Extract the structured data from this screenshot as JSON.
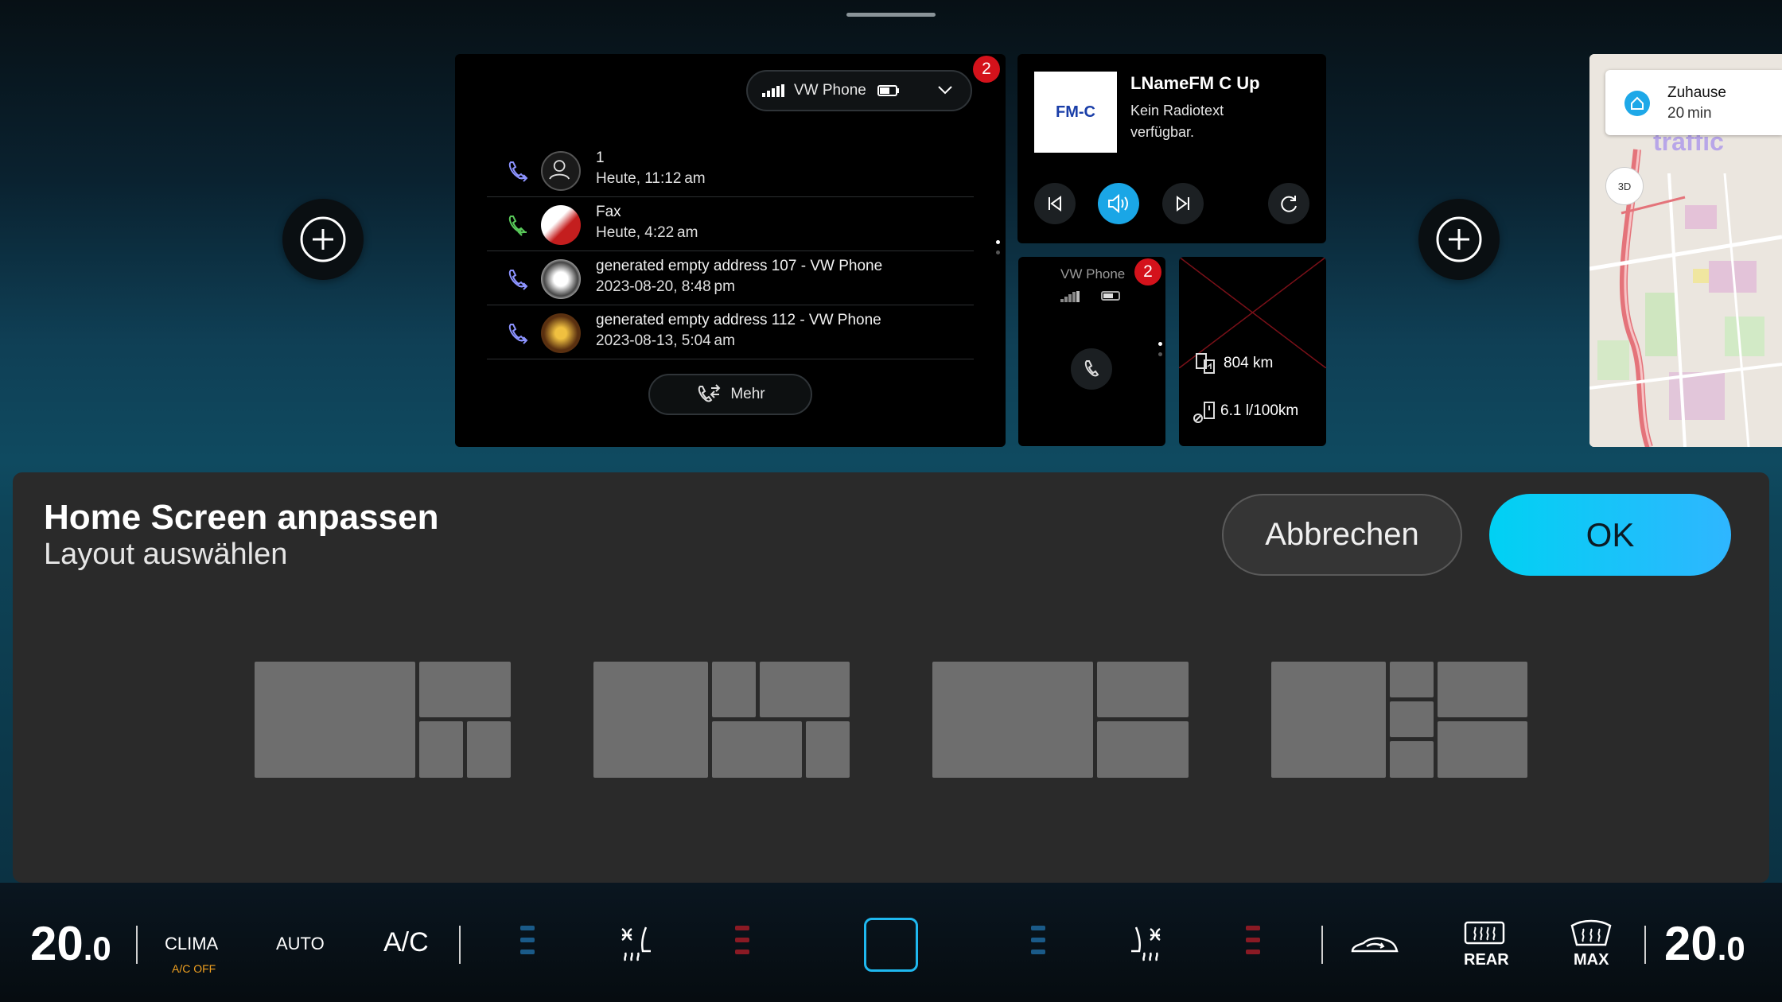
{
  "phone_tile": {
    "badge": "2",
    "device": "VW Phone",
    "calls": [
      {
        "name": "1",
        "time": "Heute, 11:12 am"
      },
      {
        "name": "Fax",
        "time": "Heute, 4:22 am"
      },
      {
        "name": "generated empty address 107 - VW Phone",
        "time": "2023-08-20, 8:48 pm"
      },
      {
        "name": "generated empty address 112 - VW Phone",
        "time": "2023-08-13, 5:04 am"
      }
    ],
    "more_label": "Mehr"
  },
  "radio_tile": {
    "logo": "FM-C",
    "station": "LNameFM C Up",
    "info": "Kein Radiotext verfügbar."
  },
  "phone_small_tile": {
    "device": "VW Phone",
    "badge": "2"
  },
  "trip_tile": {
    "range": "804 km",
    "consumption": "6.1 l/100km"
  },
  "map_tile": {
    "destination": "Zuhause",
    "eta": "20 min",
    "overlay": "traffic",
    "view_3d": "3D"
  },
  "sheet": {
    "title": "Home Screen anpassen",
    "subtitle": "Layout auswählen",
    "cancel": "Abbrechen",
    "ok": "OK"
  },
  "climate": {
    "temp_left": "20",
    "temp_left_dec": ".0",
    "clima": "CLIMA",
    "ac_off": "A/C OFF",
    "auto": "AUTO",
    "ac": "A/C",
    "rear": "REAR",
    "max": "MAX",
    "temp_right": "20",
    "temp_right_dec": ".0"
  },
  "colors": {
    "accent": "#00d1f3",
    "badge": "#d4121b",
    "heat": "#8a1a24",
    "cool": "#1a5a88",
    "ac_off": "#f0a020"
  }
}
